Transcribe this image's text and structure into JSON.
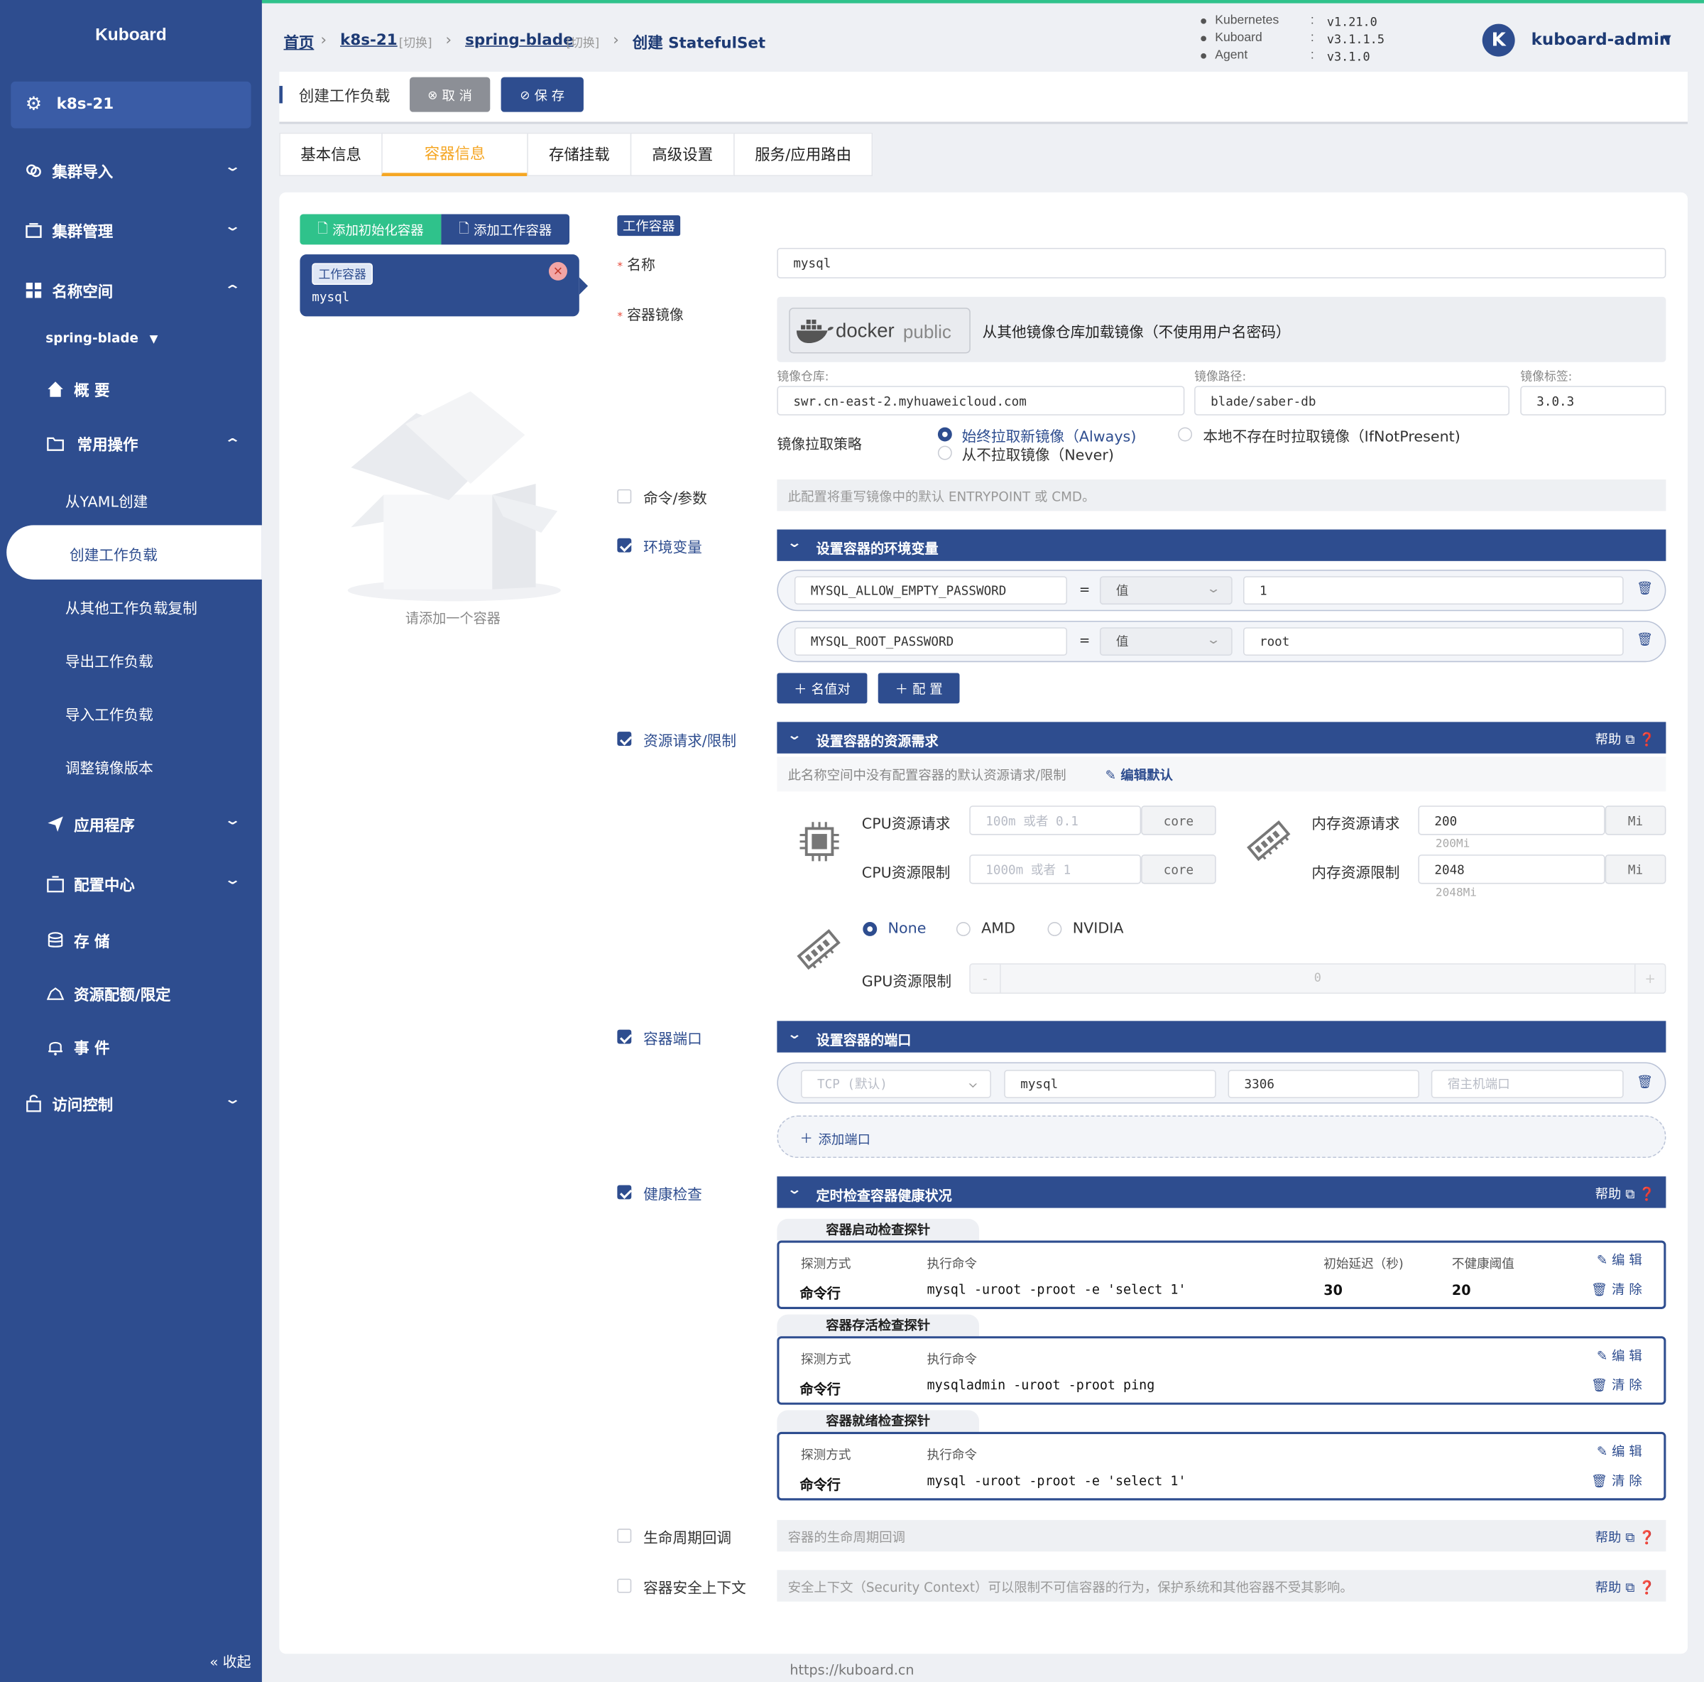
{
  "colors": {
    "primary": "#2e4d8f",
    "accent_orange": "#f5a623",
    "success_green": "#2fc28b",
    "sidebar_bg": "#2e4d8f"
  },
  "sidebar": {
    "logo": "Kuboard",
    "cluster": "k8s-21",
    "items": [
      {
        "label": "集群导入",
        "icon": "cluster-import-icon"
      },
      {
        "label": "集群管理",
        "icon": "cluster-manage-icon"
      },
      {
        "label": "名称空间",
        "icon": "grid-icon"
      }
    ],
    "namespace": "spring-blade",
    "overview": "概 要",
    "common_ops": "常用操作",
    "subitems": [
      "从YAML创建",
      "创建工作负载",
      "从其他工作负载复制",
      "导出工作负载",
      "导入工作负载",
      "调整镜像版本"
    ],
    "items2": [
      "应用程序",
      "配置中心",
      "存 储",
      "资源配额/限定",
      "事 件",
      "访问控制"
    ],
    "collapse": "收起"
  },
  "header": {
    "breadcrumb": [
      "首页",
      "k8s-21",
      "[切换]",
      "spring-blade",
      "[切换]",
      "创建 StatefulSet"
    ],
    "versions": [
      {
        "name": "Kubernetes",
        "sep": ":",
        "value": "v1.21.0"
      },
      {
        "name": "Kuboard",
        "sep": ":",
        "value": "v3.1.1.5"
      },
      {
        "name": "Agent",
        "sep": ":",
        "value": "v3.1.0"
      }
    ],
    "avatar": "K",
    "user": "kuboard-admin"
  },
  "toolbar": {
    "title": "创建工作负载",
    "cancel": "取 消",
    "save": "保 存"
  },
  "tabs": [
    "基本信息",
    "容器信息",
    "存储挂载",
    "高级设置",
    "服务/应用路由"
  ],
  "left": {
    "add_init": "添加初始化容器",
    "add_work": "添加工作容器",
    "card_tag": "工作容器",
    "card_name": "mysql",
    "empty_hint": "请添加一个容器"
  },
  "form": {
    "section_tag": "工作容器",
    "name_label": "名称",
    "name_value": "mysql",
    "image_label": "容器镜像",
    "docker_text": "docker",
    "docker_public": "public",
    "docker_desc": "从其他镜像仓库加载镜像（不使用用户名密码）",
    "repo_label": "镜像仓库:",
    "repo_value": "swr.cn-east-2.myhuaweicloud.com",
    "path_label": "镜像路径:",
    "path_value": "blade/saber-db",
    "tag_label": "镜像标签:",
    "tag_value": "3.0.3",
    "pull_label": "镜像拉取策略",
    "pull_always": "始终拉取新镜像（Always)",
    "pull_ifnot": "本地不存在时拉取镜像（IfNotPresent)",
    "pull_never": "从不拉取镜像（Never)",
    "cmd_label": "命令/参数",
    "cmd_hint": "此配置将重写镜像中的默认 ENTRYPOINT 或 CMD。",
    "env_label": "环境变量",
    "env_title": "设置容器的环境变量",
    "env": [
      {
        "name": "MYSQL_ALLOW_EMPTY_PASSWORD",
        "eq": "=",
        "type": "值",
        "value": "1"
      },
      {
        "name": "MYSQL_ROOT_PASSWORD",
        "eq": "=",
        "type": "值",
        "value": "root"
      }
    ],
    "add_kv": "名值对",
    "add_cfg": "配 置",
    "res_label": "资源请求/限制",
    "res_title": "设置容器的资源需求",
    "help": "帮助",
    "res_hint": "此名称空间中没有配置容器的默认资源请求/限制",
    "edit_default": "编辑默认",
    "cpu_req": "CPU资源请求",
    "cpu_req_ph": "100m 或者 0.1",
    "cpu_lim": "CPU资源限制",
    "cpu_lim_ph": "1000m 或者 1",
    "core": "core",
    "mem_req": "内存资源请求",
    "mem_req_v": "200",
    "mem_req_hint": "200Mi",
    "mem_lim": "内存资源限制",
    "mem_lim_v": "2048",
    "mem_lim_hint": "2048Mi",
    "mi": "Mi",
    "gpu_opts": [
      "None",
      "AMD",
      "NVIDIA"
    ],
    "gpu_lim": "GPU资源限制",
    "gpu_minus": "-",
    "gpu_plus": "+",
    "gpu_v": "0",
    "port_label": "容器端口",
    "port_title": "设置容器的端口",
    "port_proto": "TCP (默认)",
    "port_name": "mysql",
    "port_num": "3306",
    "port_host_ph": "宿主机端口",
    "add_port": "添加端口",
    "health_label": "健康检查",
    "health_title": "定时检查容器健康状况",
    "probes": [
      {
        "title": "容器启动检查探针",
        "h_method": "探测方式",
        "h_cmd": "执行命令",
        "method": "命令行",
        "cmd": "mysql -uroot -proot -e 'select 1'",
        "h_delay": "初始延迟（秒)",
        "delay": "30",
        "h_thresh": "不健康阈值",
        "thresh": "20",
        "edit": "编 辑",
        "clear": "清 除"
      },
      {
        "title": "容器存活检查探针",
        "h_method": "探测方式",
        "h_cmd": "执行命令",
        "method": "命令行",
        "cmd": "mysqladmin -uroot -proot ping",
        "edit": "编 辑",
        "clear": "清 除"
      },
      {
        "title": "容器就绪检查探针",
        "h_method": "探测方式",
        "h_cmd": "执行命令",
        "method": "命令行",
        "cmd": "mysql -uroot -proot -e 'select 1'",
        "edit": "编 辑",
        "clear": "清 除"
      }
    ],
    "life_label": "生命周期回调",
    "life_hint": "容器的生命周期回调",
    "sec_label": "容器安全上下文",
    "sec_hint": "安全上下文（Security Context）可以限制不可信容器的行为，保护系统和其他容器不受其影响。"
  },
  "footer": "https://kuboard.cn"
}
